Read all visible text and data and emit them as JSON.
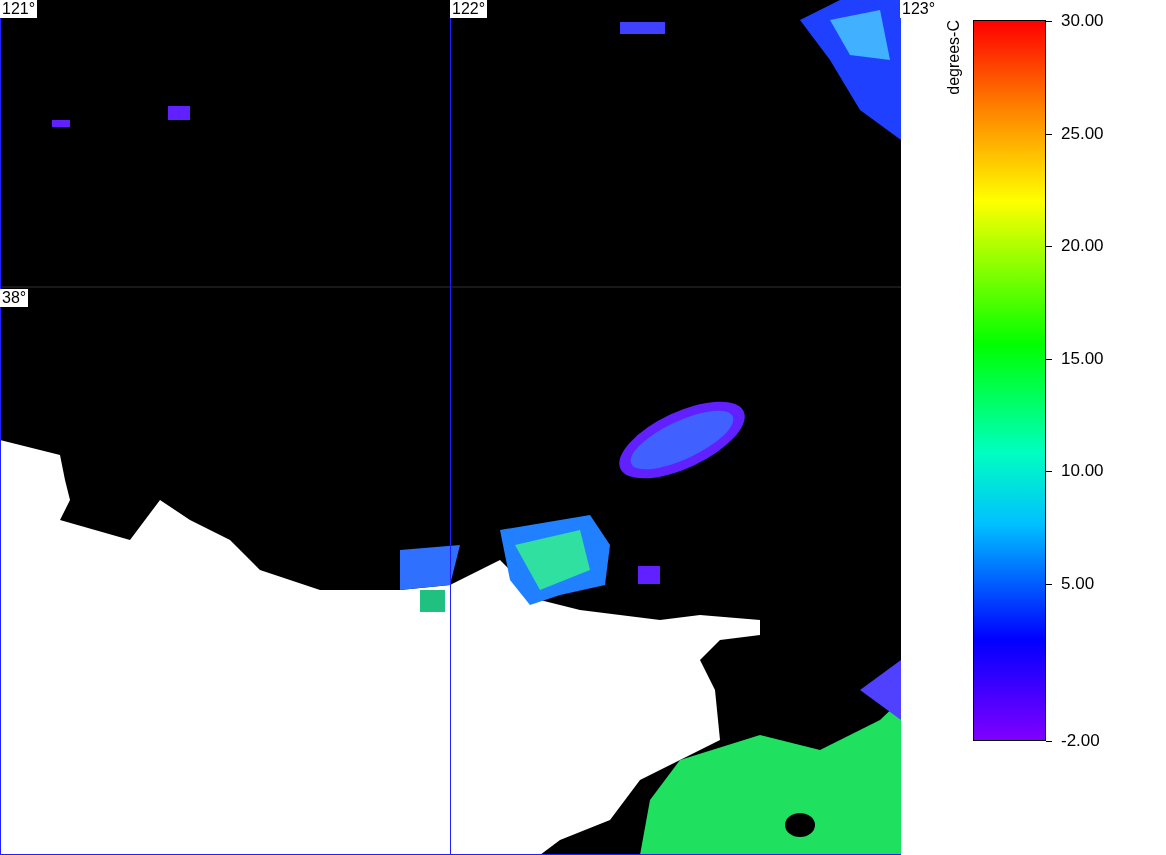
{
  "map": {
    "longitude_labels": [
      "121°",
      "122°",
      "123°"
    ],
    "latitude_labels": [
      "38°"
    ]
  },
  "color_scale": {
    "title": "degrees-C",
    "ticks": [
      "30.00",
      "25.00",
      "20.00",
      "15.00",
      "10.00",
      "5.00",
      "-2.00"
    ]
  }
}
